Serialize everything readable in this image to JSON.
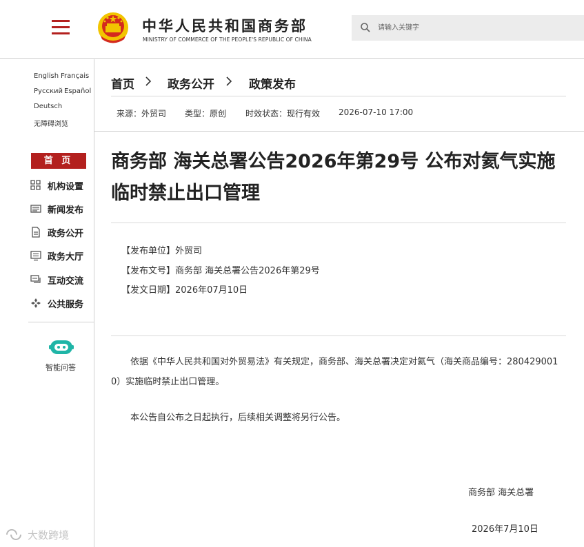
{
  "header": {
    "site_title": "中华人民共和国商务部",
    "site_subtitle": "MINISTRY OF COMMERCE OF THE PEOPLE'S REPUBLIC OF CHINA",
    "search_placeholder": "请输入关键字"
  },
  "sidebar": {
    "languages": [
      "English",
      "Français",
      "Русский",
      "Español",
      "Deutsch",
      "无障碍浏览"
    ],
    "home_label": "首 页",
    "items": [
      {
        "label": "机构设置",
        "icon": "grid-icon"
      },
      {
        "label": "新闻发布",
        "icon": "news-icon"
      },
      {
        "label": "政务公开",
        "icon": "document-icon"
      },
      {
        "label": "政务大厅",
        "icon": "monitor-icon"
      },
      {
        "label": "互动交流",
        "icon": "chat-icon"
      },
      {
        "label": "公共服务",
        "icon": "service-icon"
      }
    ],
    "assistant_label": "智能问答"
  },
  "breadcrumb": [
    "首页",
    "政务公开",
    "政策发布"
  ],
  "meta": {
    "source": "来源：外贸司",
    "type": "类型：原创",
    "status": "时效状态：现行有效",
    "datetime": "2026-07-10 17:00"
  },
  "article": {
    "title": "商务部 海关总署公告2026年第29号 公布对氦气实施临时禁止出口管理",
    "info": [
      "【发布单位】外贸司",
      "【发布文号】商务部 海关总署公告2026年第29号",
      "【发文日期】2026年07月10日"
    ],
    "paragraphs": [
      "依据《中华人民共和国对外贸易法》有关规定，商务部、海关总署决定对氦气（海关商品编号：2804290010）实施临时禁止出口管理。",
      "本公告自公布之日起执行，后续相关调整将另行公告。"
    ],
    "signature": "商务部 海关总署",
    "date": "2026年7月10日"
  },
  "watermark": "大数跨境",
  "colors": {
    "brand_red": "#b3201e",
    "emblem_gold": "#f2c500",
    "robot_teal": "#1fb5a7"
  }
}
